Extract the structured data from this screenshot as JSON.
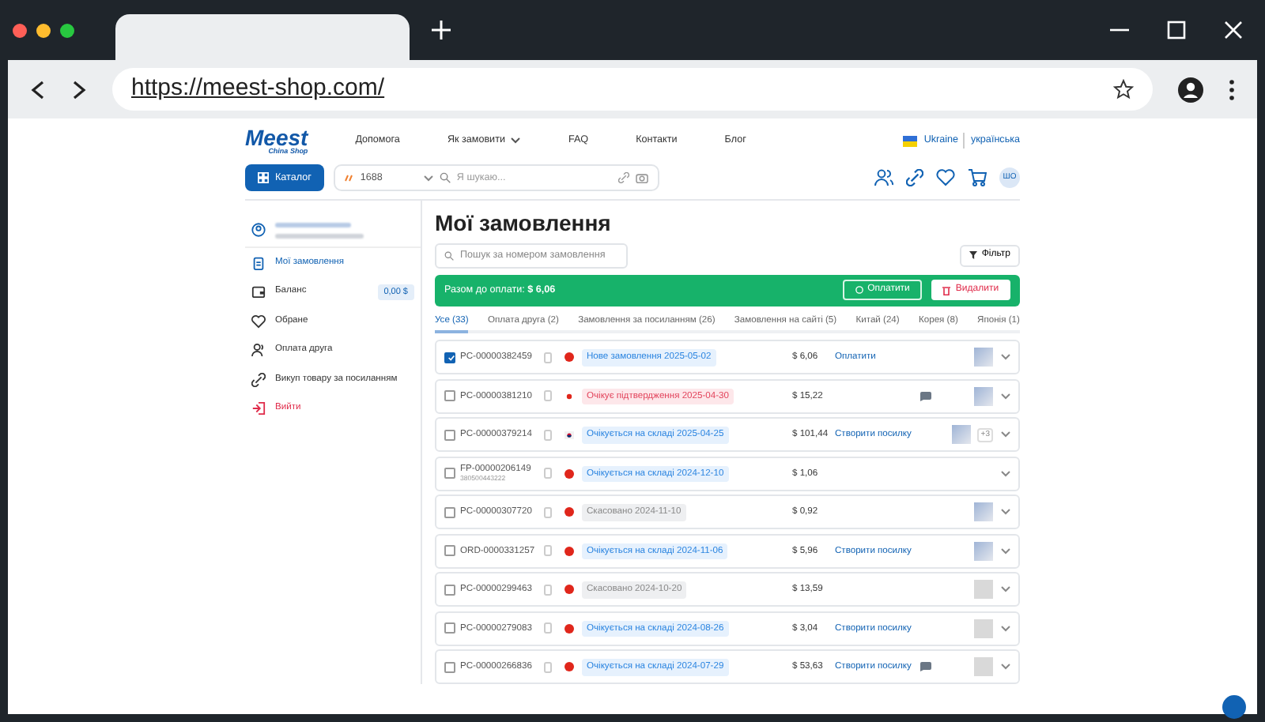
{
  "browser": {
    "url": "https://meest-shop.com/"
  },
  "header": {
    "logo": "Meest",
    "logo_sub": "China Shop",
    "nav": [
      {
        "label": "Допомога",
        "dropdown": false
      },
      {
        "label": "Як замовити",
        "dropdown": true
      },
      {
        "label": "FAQ",
        "dropdown": false
      },
      {
        "label": "Контакти",
        "dropdown": false
      },
      {
        "label": "Блог",
        "dropdown": false
      }
    ],
    "region": "Ukraine",
    "language": "українська",
    "catalog_button": "Каталог",
    "source": "1688",
    "search_placeholder": "Я шукаю...",
    "avatar": "ШО"
  },
  "sidebar": {
    "items": [
      {
        "kind": "orders",
        "label": "Мої замовлення",
        "selected": true
      },
      {
        "kind": "balance",
        "label": "Баланс",
        "selected": false,
        "badge": "0,00 $"
      },
      {
        "kind": "favorites",
        "label": "Обране",
        "selected": false
      },
      {
        "kind": "friend",
        "label": "Оплата друга",
        "selected": false
      },
      {
        "kind": "link",
        "label": "Викуп товару за посиланням",
        "selected": false
      },
      {
        "kind": "logout",
        "label": "Вийти",
        "selected": false
      }
    ]
  },
  "page_title": "Мої замовлення",
  "order_search": {
    "placeholder": "Пошук за номером замовлення"
  },
  "filter_button": "Фільтр",
  "pay_bar": {
    "label": "Разом до оплати:",
    "amount": "$ 6,06",
    "pay_button": "Оплатити",
    "delete_button": "Видалити"
  },
  "tabs": [
    {
      "label": "Усе (33)",
      "selected": true
    },
    {
      "label": "Оплата друга (2)",
      "selected": false
    },
    {
      "label": "Замовлення за посиланням (26)",
      "selected": false
    },
    {
      "label": "Замовлення на сайті (5)",
      "selected": false
    },
    {
      "label": "Китай (24)",
      "selected": false
    },
    {
      "label": "Корея (8)",
      "selected": false
    },
    {
      "label": "Японія (1)",
      "selected": false
    }
  ],
  "orders": [
    {
      "id": "PC-00000382459",
      "checked": true,
      "flag": {
        "kind": "china"
      },
      "status": {
        "text": "Нове замовлення 2025-05-02",
        "kind": "info"
      },
      "price": "$ 6,06",
      "action": "Оплатити",
      "comment": false,
      "thumb": {
        "kind": "photo"
      }
    },
    {
      "id": "PC-00000381210",
      "checked": false,
      "flag": {
        "kind": "dot"
      },
      "status": {
        "text": "Очікує підтвердження 2025-04-30",
        "kind": "pending"
      },
      "price": "$ 15,22",
      "comment": true,
      "thumb": {
        "kind": "photo"
      }
    },
    {
      "id": "PC-00000379214",
      "checked": false,
      "flag": {
        "kind": "korea"
      },
      "status": {
        "text": "Очікується на складі 2025-04-25",
        "kind": "info"
      },
      "price": "$ 101,44",
      "action": "Створити посилку",
      "comment": false,
      "thumb": {
        "kind": "photo"
      },
      "more": "+3"
    },
    {
      "id": "FP-00000206149",
      "sub": "380500443222",
      "checked": false,
      "flag": {
        "kind": "china"
      },
      "status": {
        "text": "Очікується на складі 2024-12-10",
        "kind": "info"
      },
      "price": "$ 1,06",
      "comment": false
    },
    {
      "id": "PC-00000307720",
      "checked": false,
      "flag": {
        "kind": "china"
      },
      "status": {
        "text": "Скасовано 2024-11-10",
        "kind": "cancelled"
      },
      "price": "$ 0,92",
      "comment": false,
      "thumb": {
        "kind": "photo"
      }
    },
    {
      "id": "ORD-0000331257",
      "checked": false,
      "flag": {
        "kind": "china"
      },
      "status": {
        "text": "Очікується на складі 2024-11-06",
        "kind": "info"
      },
      "price": "$ 5,96",
      "action": "Створити посилку",
      "comment": false,
      "thumb": {
        "kind": "photo"
      }
    },
    {
      "id": "PC-00000299463",
      "checked": false,
      "flag": {
        "kind": "china"
      },
      "status": {
        "text": "Скасовано 2024-10-20",
        "kind": "cancelled"
      },
      "price": "$ 13,59",
      "comment": false,
      "thumb": {
        "kind": "broken"
      }
    },
    {
      "id": "PC-00000279083",
      "checked": false,
      "flag": {
        "kind": "china"
      },
      "status": {
        "text": "Очікується на складі 2024-08-26",
        "kind": "info"
      },
      "price": "$ 3,04",
      "action": "Створити посилку",
      "comment": false,
      "thumb": {
        "kind": "broken"
      }
    },
    {
      "id": "PC-00000266836",
      "checked": false,
      "flag": {
        "kind": "china"
      },
      "status": {
        "text": "Очікується на складі 2024-07-29",
        "kind": "info"
      },
      "price": "$ 53,63",
      "action": "Створити посилку",
      "comment": true,
      "thumb": {
        "kind": "broken"
      }
    }
  ]
}
